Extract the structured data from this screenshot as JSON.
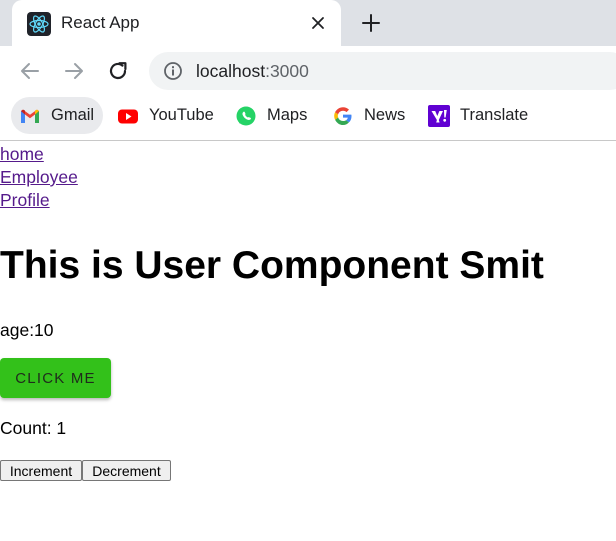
{
  "browser": {
    "tab": {
      "title": "React App",
      "favicon": "react-logo-icon",
      "close_icon": "close-icon"
    },
    "new_tab_icon": "plus-icon",
    "toolbar": {
      "back_icon": "back-arrow-icon",
      "forward_icon": "forward-arrow-icon",
      "reload_icon": "reload-icon",
      "site_info_icon": "info-icon",
      "url_host": "localhost",
      "url_port": ":3000"
    },
    "bookmarks": [
      {
        "label": "Gmail",
        "icon": "gmail-icon"
      },
      {
        "label": "YouTube",
        "icon": "youtube-icon"
      },
      {
        "label": "Maps",
        "icon": "maps-icon"
      },
      {
        "label": "News",
        "icon": "google-news-icon"
      },
      {
        "label": "Translate",
        "icon": "yahoo-icon"
      }
    ]
  },
  "page": {
    "nav_links": [
      "home",
      "Employee",
      "Profile"
    ],
    "heading": "This is User Component Smit",
    "age_text": "age:10",
    "click_button": "CLICK ME",
    "count_text": "Count: 1",
    "increment_button": "Increment",
    "decrement_button": "Decrement"
  },
  "colors": {
    "tab_strip": "#dee1e6",
    "visited_link": "#551a8b",
    "click_button_bg": "#33c11a"
  }
}
